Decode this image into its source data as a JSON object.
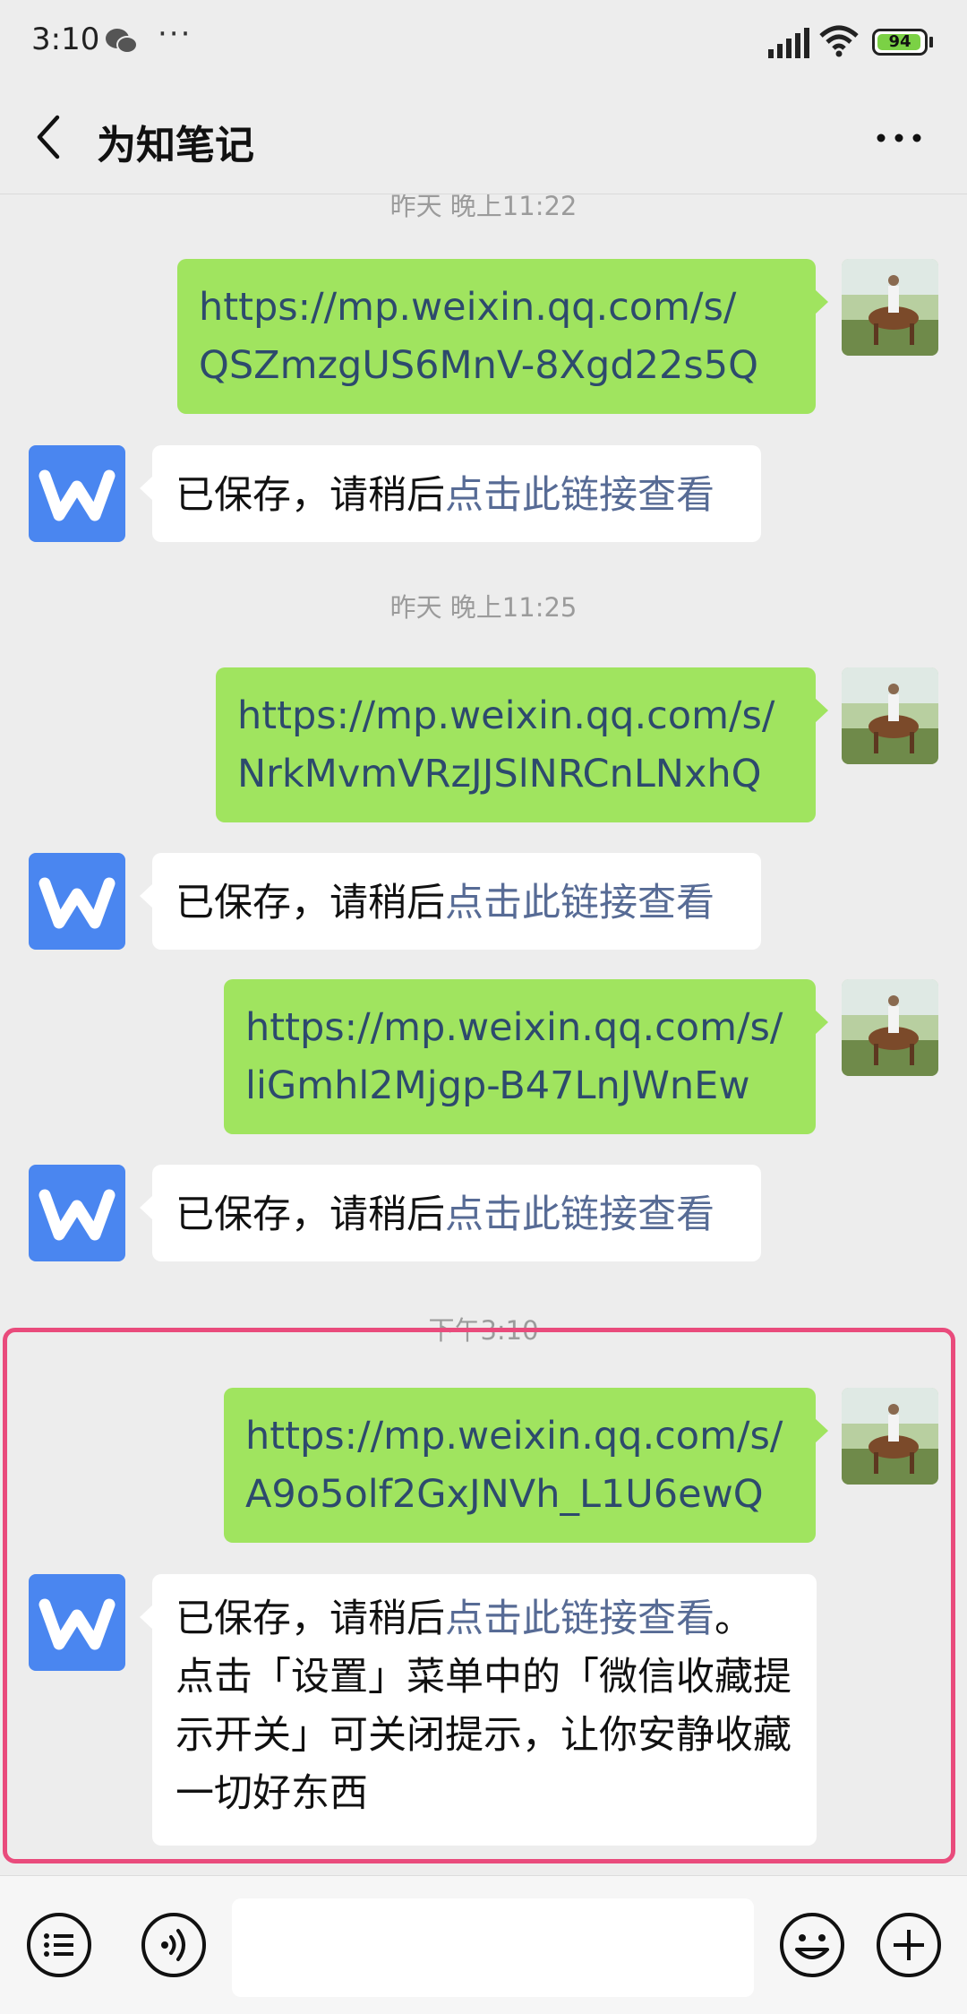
{
  "status_bar": {
    "time": "3:10",
    "more": "···",
    "battery": "94",
    "icons": [
      "wechat-icon",
      "cellular-signal-icon",
      "wifi-icon",
      "battery-icon"
    ]
  },
  "nav": {
    "title": "为知笔记",
    "back_icon": "chevron-left-icon",
    "more_icon": "more-dots-icon"
  },
  "messages": [
    {
      "kind": "timestamp",
      "text": "昨天 晚上11:22"
    },
    {
      "kind": "sent",
      "lines": [
        "https://mp.weixin.qq.com/s/",
        "QSZmzgUS6MnV-8Xgd22s5Q"
      ]
    },
    {
      "kind": "received",
      "text": "已保存，请稍后",
      "link": "点击此链接查看"
    },
    {
      "kind": "timestamp",
      "text": "昨天 晚上11:25"
    },
    {
      "kind": "sent",
      "lines": [
        "https://mp.weixin.qq.com/s/",
        "NrkMvmVRzJJSlNRCnLNxhQ"
      ]
    },
    {
      "kind": "received",
      "text": "已保存，请稍后",
      "link": "点击此链接查看"
    },
    {
      "kind": "sent",
      "lines": [
        "https://mp.weixin.qq.com/s/",
        "liGmhl2Mjgp-B47LnJWnEw"
      ]
    },
    {
      "kind": "received",
      "text": "已保存，请稍后",
      "link": "点击此链接查看"
    },
    {
      "kind": "timestamp",
      "text": "下午3:10"
    },
    {
      "kind": "sent",
      "lines": [
        "https://mp.weixin.qq.com/s/",
        "A9o5olf2GxJNVh_L1U6ewQ"
      ]
    },
    {
      "kind": "received",
      "text": "已保存，请稍后",
      "link": "点击此链接查看",
      "tail_lines": [
        "。",
        "点击「设置」菜单中的「微信收藏提",
        "示开关」可关闭提示，让你安静收藏",
        "一切好东西"
      ]
    }
  ],
  "input_bar": {
    "value": "",
    "icons": [
      "menu-list-icon",
      "voice-icon",
      "emoji-icon",
      "plus-icon"
    ]
  },
  "colors": {
    "background": "#ededed",
    "sent_bubble": "#a0e45f",
    "received_bubble": "#ffffff",
    "link": "#576b95",
    "highlight_border": "#e94b7c",
    "app_avatar": "#4a86f0"
  }
}
